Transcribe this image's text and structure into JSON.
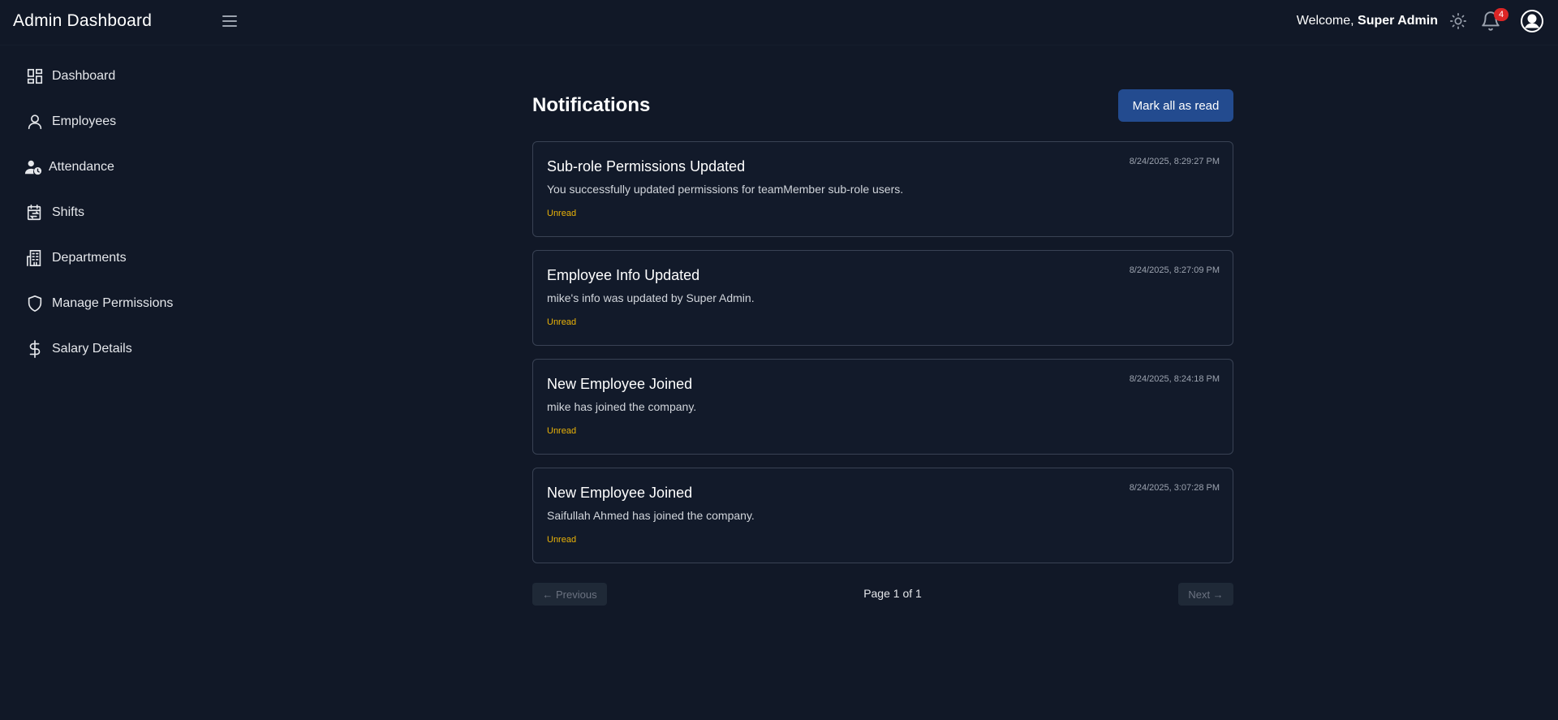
{
  "header": {
    "app_title": "Admin Dashboard",
    "welcome_prefix": "Welcome, ",
    "user_name": "Super Admin",
    "notification_count": "4"
  },
  "sidebar": {
    "items": [
      {
        "label": "Dashboard",
        "icon": "dashboard-grid-icon"
      },
      {
        "label": "Employees",
        "icon": "user-icon"
      },
      {
        "label": "Attendance",
        "icon": "user-clock-icon"
      },
      {
        "label": "Shifts",
        "icon": "calendar-swap-icon"
      },
      {
        "label": "Departments",
        "icon": "building-icon"
      },
      {
        "label": "Manage Permissions",
        "icon": "shield-icon"
      },
      {
        "label": "Salary Details",
        "icon": "dollar-icon"
      }
    ]
  },
  "main": {
    "title": "Notifications",
    "mark_all_label": "Mark all as read",
    "notifications": [
      {
        "title": "Sub-role Permissions Updated",
        "message": "You successfully updated permissions for teamMember sub-role users.",
        "status": "Unread",
        "timestamp": "8/24/2025, 8:29:27 PM"
      },
      {
        "title": "Employee Info Updated",
        "message": "mike's info was updated by Super Admin.",
        "status": "Unread",
        "timestamp": "8/24/2025, 8:27:09 PM"
      },
      {
        "title": "New Employee Joined",
        "message": "mike has joined the company.",
        "status": "Unread",
        "timestamp": "8/24/2025, 8:24:18 PM"
      },
      {
        "title": "New Employee Joined",
        "message": "Saifullah Ahmed has joined the company.",
        "status": "Unread",
        "timestamp": "8/24/2025, 3:07:28 PM"
      }
    ],
    "pagination": {
      "prev_label": "← Previous",
      "page_info": "Page 1 of 1",
      "next_label": "Next →"
    }
  },
  "colors": {
    "background": "#111827",
    "primary_button": "#234b8f",
    "unread_status": "#eab308",
    "badge": "#dc2626"
  }
}
